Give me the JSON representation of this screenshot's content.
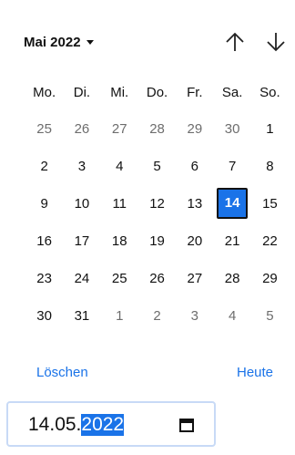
{
  "header": {
    "month_label": "Mai 2022",
    "month_dropdown_icon": "caret-down-icon",
    "prev_icon": "arrow-up-icon",
    "next_icon": "arrow-down-icon"
  },
  "weekdays": [
    "Mo.",
    "Di.",
    "Mi.",
    "Do.",
    "Fr.",
    "Sa.",
    "So."
  ],
  "weeks": [
    [
      {
        "d": "25",
        "other": true
      },
      {
        "d": "26",
        "other": true
      },
      {
        "d": "27",
        "other": true
      },
      {
        "d": "28",
        "other": true
      },
      {
        "d": "29",
        "other": true
      },
      {
        "d": "30",
        "other": true
      },
      {
        "d": "1"
      }
    ],
    [
      {
        "d": "2"
      },
      {
        "d": "3"
      },
      {
        "d": "4"
      },
      {
        "d": "5"
      },
      {
        "d": "6"
      },
      {
        "d": "7"
      },
      {
        "d": "8"
      }
    ],
    [
      {
        "d": "9"
      },
      {
        "d": "10"
      },
      {
        "d": "11"
      },
      {
        "d": "12"
      },
      {
        "d": "13"
      },
      {
        "d": "14",
        "selected": true
      },
      {
        "d": "15"
      }
    ],
    [
      {
        "d": "16"
      },
      {
        "d": "17"
      },
      {
        "d": "18"
      },
      {
        "d": "19"
      },
      {
        "d": "20"
      },
      {
        "d": "21"
      },
      {
        "d": "22"
      }
    ],
    [
      {
        "d": "23"
      },
      {
        "d": "24"
      },
      {
        "d": "25"
      },
      {
        "d": "26"
      },
      {
        "d": "27"
      },
      {
        "d": "28"
      },
      {
        "d": "29"
      }
    ],
    [
      {
        "d": "30"
      },
      {
        "d": "31"
      },
      {
        "d": "1",
        "other": true
      },
      {
        "d": "2",
        "other": true
      },
      {
        "d": "3",
        "other": true
      },
      {
        "d": "4",
        "other": true
      },
      {
        "d": "5",
        "other": true
      }
    ]
  ],
  "footer": {
    "clear_label": "Löschen",
    "today_label": "Heute"
  },
  "input": {
    "day_month": "14.05.",
    "year": "2022",
    "calendar_icon": "calendar-icon"
  },
  "colors": {
    "accent": "#1a73e8",
    "other_month_text": "#6d6d6d",
    "input_border": "#c8daf6"
  }
}
